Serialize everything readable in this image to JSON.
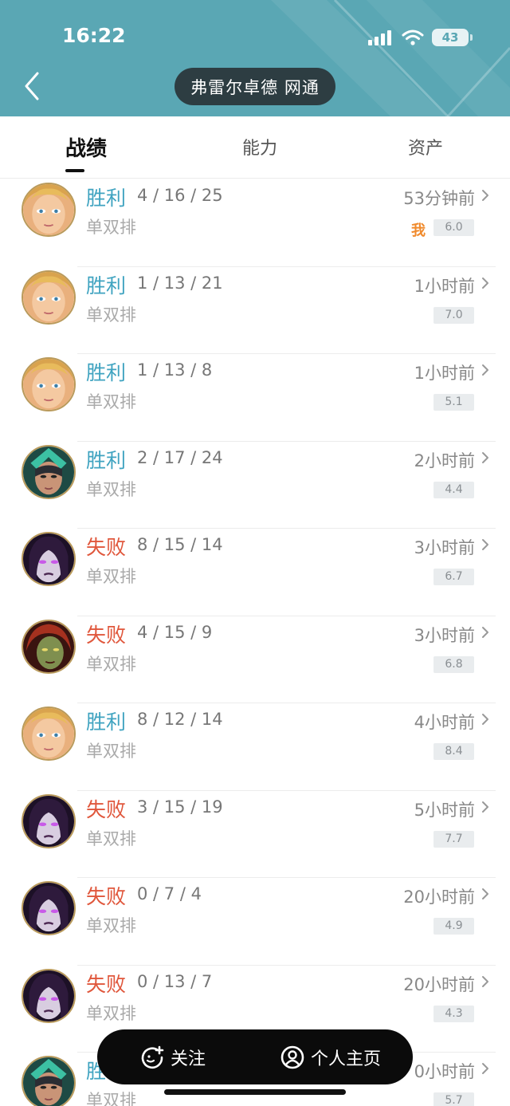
{
  "status_bar": {
    "time": "16:22",
    "battery": "43"
  },
  "header": {
    "title": "弗雷尔卓德 网通"
  },
  "tabs": [
    {
      "label": "战绩",
      "active": true
    },
    {
      "label": "能力",
      "active": false
    },
    {
      "label": "资产",
      "active": false
    }
  ],
  "colors": {
    "win": "#3fa3c0",
    "loss": "#e0573c",
    "header_bg": "#5aa7b4",
    "title_pill": "#2d3d42"
  },
  "matches": [
    {
      "result": "胜利",
      "outcome": "win",
      "kda": "4 / 16 / 25",
      "mode": "单双排",
      "time": "53分钟前",
      "score": "6.0",
      "badge": "我",
      "hero": "blonde-hero"
    },
    {
      "result": "胜利",
      "outcome": "win",
      "kda": "1 / 13 / 21",
      "mode": "单双排",
      "time": "1小时前",
      "score": "7.0",
      "badge": "",
      "hero": "blonde-hero"
    },
    {
      "result": "胜利",
      "outcome": "win",
      "kda": "1 / 13 / 8",
      "mode": "单双排",
      "time": "1小时前",
      "score": "5.1",
      "badge": "",
      "hero": "blonde-hero"
    },
    {
      "result": "胜利",
      "outcome": "win",
      "kda": "2 / 17 / 24",
      "mode": "单双排",
      "time": "2小时前",
      "score": "4.4",
      "badge": "",
      "hero": "teal-hero"
    },
    {
      "result": "失败",
      "outcome": "loss",
      "kda": "8 / 15 / 14",
      "mode": "单双排",
      "time": "3小时前",
      "score": "6.7",
      "badge": "",
      "hero": "purple-hero"
    },
    {
      "result": "失败",
      "outcome": "loss",
      "kda": "4 / 15 / 9",
      "mode": "单双排",
      "time": "3小时前",
      "score": "6.8",
      "badge": "",
      "hero": "red-hero"
    },
    {
      "result": "胜利",
      "outcome": "win",
      "kda": "8 / 12 / 14",
      "mode": "单双排",
      "time": "4小时前",
      "score": "8.4",
      "badge": "",
      "hero": "blonde-hero"
    },
    {
      "result": "失败",
      "outcome": "loss",
      "kda": "3 / 15 / 19",
      "mode": "单双排",
      "time": "5小时前",
      "score": "7.7",
      "badge": "",
      "hero": "purple-hero"
    },
    {
      "result": "失败",
      "outcome": "loss",
      "kda": "0 / 7 / 4",
      "mode": "单双排",
      "time": "20小时前",
      "score": "4.9",
      "badge": "",
      "hero": "purple-hero"
    },
    {
      "result": "失败",
      "outcome": "loss",
      "kda": "0 / 13 / 7",
      "mode": "单双排",
      "time": "20小时前",
      "score": "4.3",
      "badge": "",
      "hero": "purple-hero"
    },
    {
      "result": "胜",
      "outcome": "win",
      "kda": "",
      "mode": "单双排",
      "time": "0小时前",
      "score": "5.7",
      "badge": "",
      "hero": "teal-hero"
    }
  ],
  "bottom_bar": {
    "follow_label": "关注",
    "profile_label": "个人主页"
  }
}
